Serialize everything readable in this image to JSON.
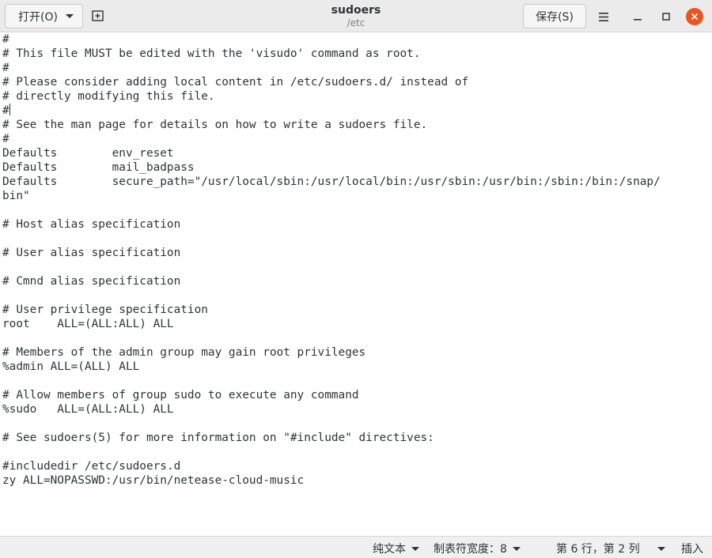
{
  "header": {
    "open_label": "打开(O)",
    "title": "sudoers",
    "subtitle": "/etc",
    "save_label": "保存(S)"
  },
  "editor": {
    "lines": [
      "#",
      "# This file MUST be edited with the 'visudo' command as root.",
      "#",
      "# Please consider adding local content in /etc/sudoers.d/ instead of",
      "# directly modifying this file.",
      "#",
      "# See the man page for details on how to write a sudoers file.",
      "#",
      "Defaults        env_reset",
      "Defaults        mail_badpass",
      "Defaults        secure_path=\"/usr/local/sbin:/usr/local/bin:/usr/sbin:/usr/bin:/sbin:/bin:/snap/",
      "bin\"",
      "",
      "# Host alias specification",
      "",
      "# User alias specification",
      "",
      "# Cmnd alias specification",
      "",
      "# User privilege specification",
      "root    ALL=(ALL:ALL) ALL",
      "",
      "# Members of the admin group may gain root privileges",
      "%admin ALL=(ALL) ALL",
      "",
      "# Allow members of group sudo to execute any command",
      "%sudo   ALL=(ALL:ALL) ALL",
      "",
      "# See sudoers(5) for more information on \"#include\" directives:",
      "",
      "#includedir /etc/sudoers.d",
      "zy ALL=NOPASSWD:/usr/bin/netease-cloud-music"
    ]
  },
  "statusbar": {
    "language": "纯文本",
    "tab_width": "制表符宽度：8",
    "position": "第 6 行，第 2 列",
    "insert_mode": "插入"
  }
}
